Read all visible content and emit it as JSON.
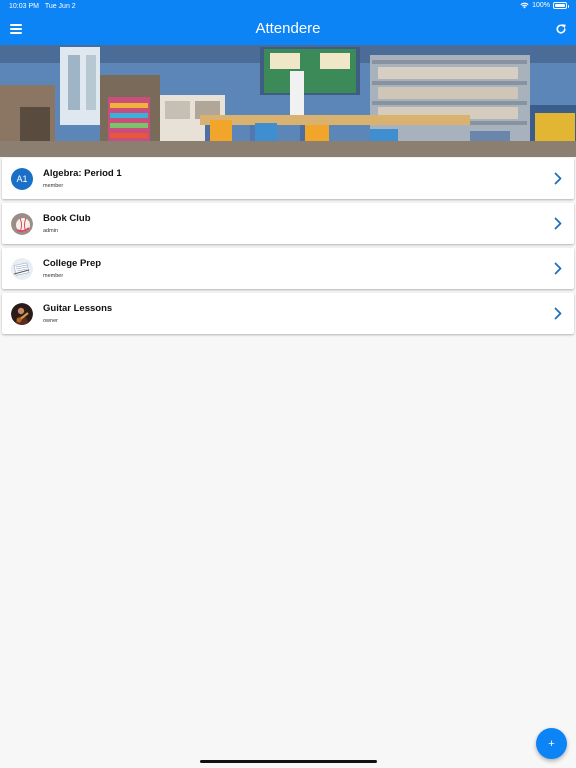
{
  "status_bar": {
    "time": "10:03 PM",
    "date": "Tue Jun 2",
    "battery": "100%"
  },
  "header": {
    "title": "Attendere",
    "menu_icon": "hamburger-menu-icon",
    "refresh_icon": "refresh-icon"
  },
  "banner": {
    "image": "classroom-photo"
  },
  "groups": [
    {
      "initials": "A1",
      "name": "Algebra: Period 1",
      "role": "member",
      "avatar": "initials"
    },
    {
      "initials": "",
      "name": "Book Club",
      "role": "admin",
      "avatar": "baseball-photo"
    },
    {
      "initials": "",
      "name": "College Prep",
      "role": "member",
      "avatar": "notebook-photo"
    },
    {
      "initials": "",
      "name": "Guitar Lessons",
      "role": "owner",
      "avatar": "guitarist-photo"
    }
  ],
  "fab": {
    "label": "+"
  },
  "colors": {
    "primary": "#0d84f6",
    "avatar_initials_bg": "#1b6fc7",
    "chevron": "#1f6fc0",
    "background": "#f7f7f7"
  }
}
